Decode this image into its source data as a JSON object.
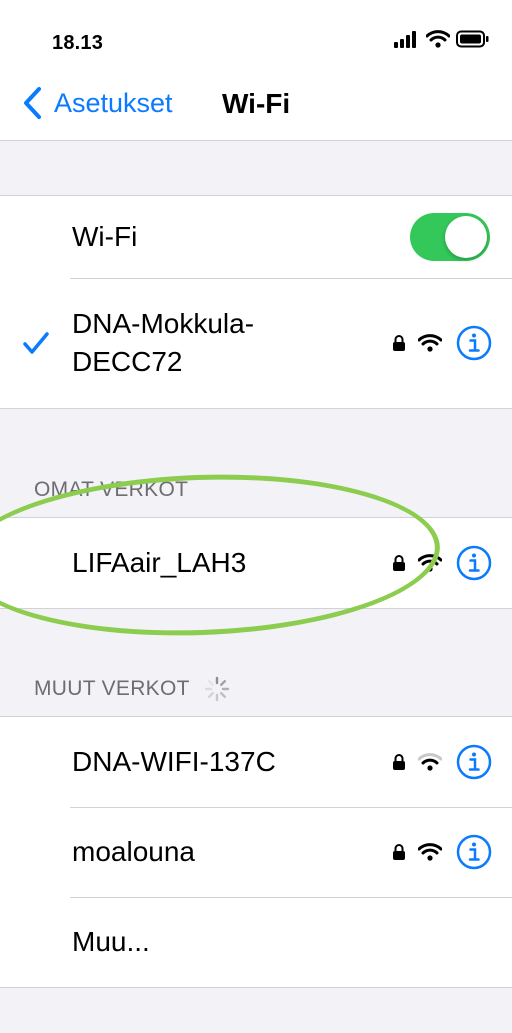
{
  "status_bar": {
    "time": "18.13"
  },
  "nav": {
    "back_label": "Asetukset",
    "title": "Wi-Fi"
  },
  "wifi_section": {
    "toggle_label": "Wi-Fi",
    "toggle_on": true,
    "connected_network": "DNA-Mokkula-DECC72"
  },
  "my_networks": {
    "header": "OMAT VERKOT",
    "networks": [
      {
        "name": "LIFAair_LAH3",
        "locked": true
      }
    ]
  },
  "other_networks": {
    "header": "MUUT VERKOT",
    "networks": [
      {
        "name": "DNA-WIFI-137C",
        "locked": true
      },
      {
        "name": "moalouna",
        "locked": true
      }
    ],
    "other_label": "Muu..."
  },
  "colors": {
    "accent": "#0a7aff",
    "toggle_on": "#34c759",
    "annotation": "#8ccc4e",
    "background": "#f2f2f7"
  },
  "icons": [
    "chevron-left-icon",
    "checkmark-icon",
    "lock-icon",
    "wifi-icon",
    "info-icon",
    "spinner-icon",
    "signal-icon",
    "battery-icon"
  ]
}
